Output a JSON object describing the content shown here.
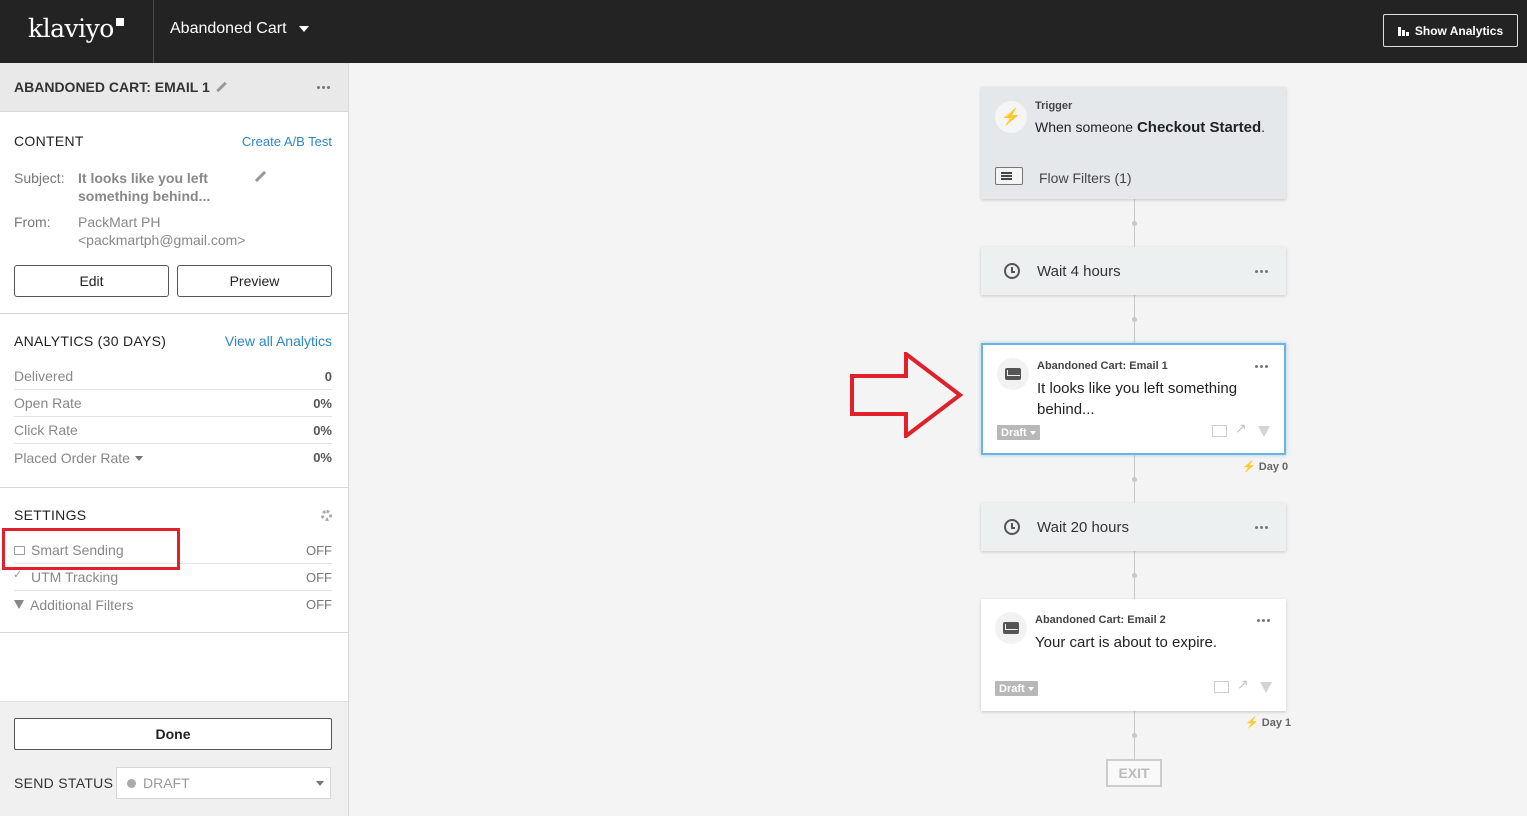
{
  "topbar": {
    "logo": "klaviyo",
    "flow_title": "Abandoned Cart",
    "show_analytics": "Show Analytics"
  },
  "sidebar": {
    "title": "ABANDONED CART: EMAIL 1",
    "content": {
      "heading": "CONTENT",
      "ab_test": "Create A/B Test",
      "subject_label": "Subject:",
      "subject_value": "It looks like you left something behind...",
      "from_label": "From:",
      "from_name": "PackMart PH",
      "from_email": "<packmartph@gmail.com>",
      "edit": "Edit",
      "preview": "Preview"
    },
    "analytics": {
      "heading": "ANALYTICS (30 DAYS)",
      "view_all": "View all Analytics",
      "rows": [
        {
          "label": "Delivered",
          "value": "0"
        },
        {
          "label": "Open Rate",
          "value": "0%"
        },
        {
          "label": "Click Rate",
          "value": "0%"
        },
        {
          "label": "Placed Order Rate",
          "value": "0%"
        }
      ]
    },
    "settings": {
      "heading": "SETTINGS",
      "rows": [
        {
          "label": "Smart Sending",
          "value": "OFF",
          "icon": "envelope-icon"
        },
        {
          "label": "UTM Tracking",
          "value": "OFF",
          "icon": "checkmark-icon"
        },
        {
          "label": "Additional Filters",
          "value": "OFF",
          "icon": "funnel-icon"
        }
      ]
    },
    "footer": {
      "done": "Done",
      "send_status_label": "SEND STATUS",
      "send_status_value": "DRAFT"
    }
  },
  "flow": {
    "trigger": {
      "label": "Trigger",
      "prefix": "When someone ",
      "event": "Checkout Started",
      "suffix": ".",
      "filters": "Flow Filters (1)"
    },
    "wait1": "Wait 4 hours",
    "email1": {
      "label": "Abandoned Cart: Email 1",
      "subject": "It looks like you left something behind...",
      "status": "Draft",
      "day": "Day 0"
    },
    "wait2": "Wait 20 hours",
    "email2": {
      "label": "Abandoned Cart: Email 2",
      "subject": "Your cart is about to expire.",
      "status": "Draft",
      "day": "Day 1"
    },
    "exit": "EXIT"
  },
  "colors": {
    "topbar": "#232323",
    "link": "#2b87c4",
    "annotation_red": "#e0202a",
    "selected_border": "#6ab4e0"
  }
}
